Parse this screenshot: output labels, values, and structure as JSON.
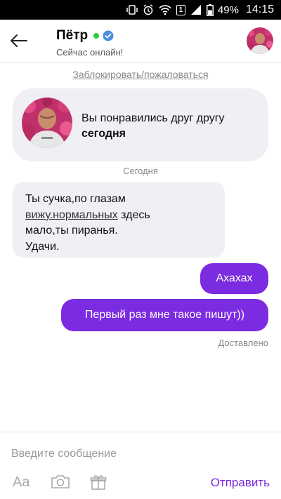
{
  "status_bar": {
    "battery_percent": "49%",
    "time": "14:15",
    "sim_label": "1"
  },
  "header": {
    "name": "Пётр",
    "status": "Сейчас онлайн!",
    "online_color": "#2ecc40",
    "verified_color": "#4a90e2"
  },
  "chat": {
    "block_link": "Заблокировать/пожаловаться",
    "match": {
      "text": "Вы понравились друг другу",
      "when": "сегодня"
    },
    "day_label": "Сегодня",
    "incoming": {
      "line1": "Ты сучка,по глазам",
      "link": "вижу.нормальных",
      "after_link": " здесь",
      "line3": "мало,ты пиранья.",
      "line4": "Удачи."
    },
    "outgoing": [
      {
        "text": "Ахахах"
      },
      {
        "text": "Первый раз мне такое пишут))"
      }
    ],
    "delivered": "Доставлено"
  },
  "composer": {
    "placeholder": "Введите сообщение",
    "value": "",
    "font_tool_label": "Aa",
    "send_label": "Отправить",
    "accent_color": "#7b2be0"
  }
}
